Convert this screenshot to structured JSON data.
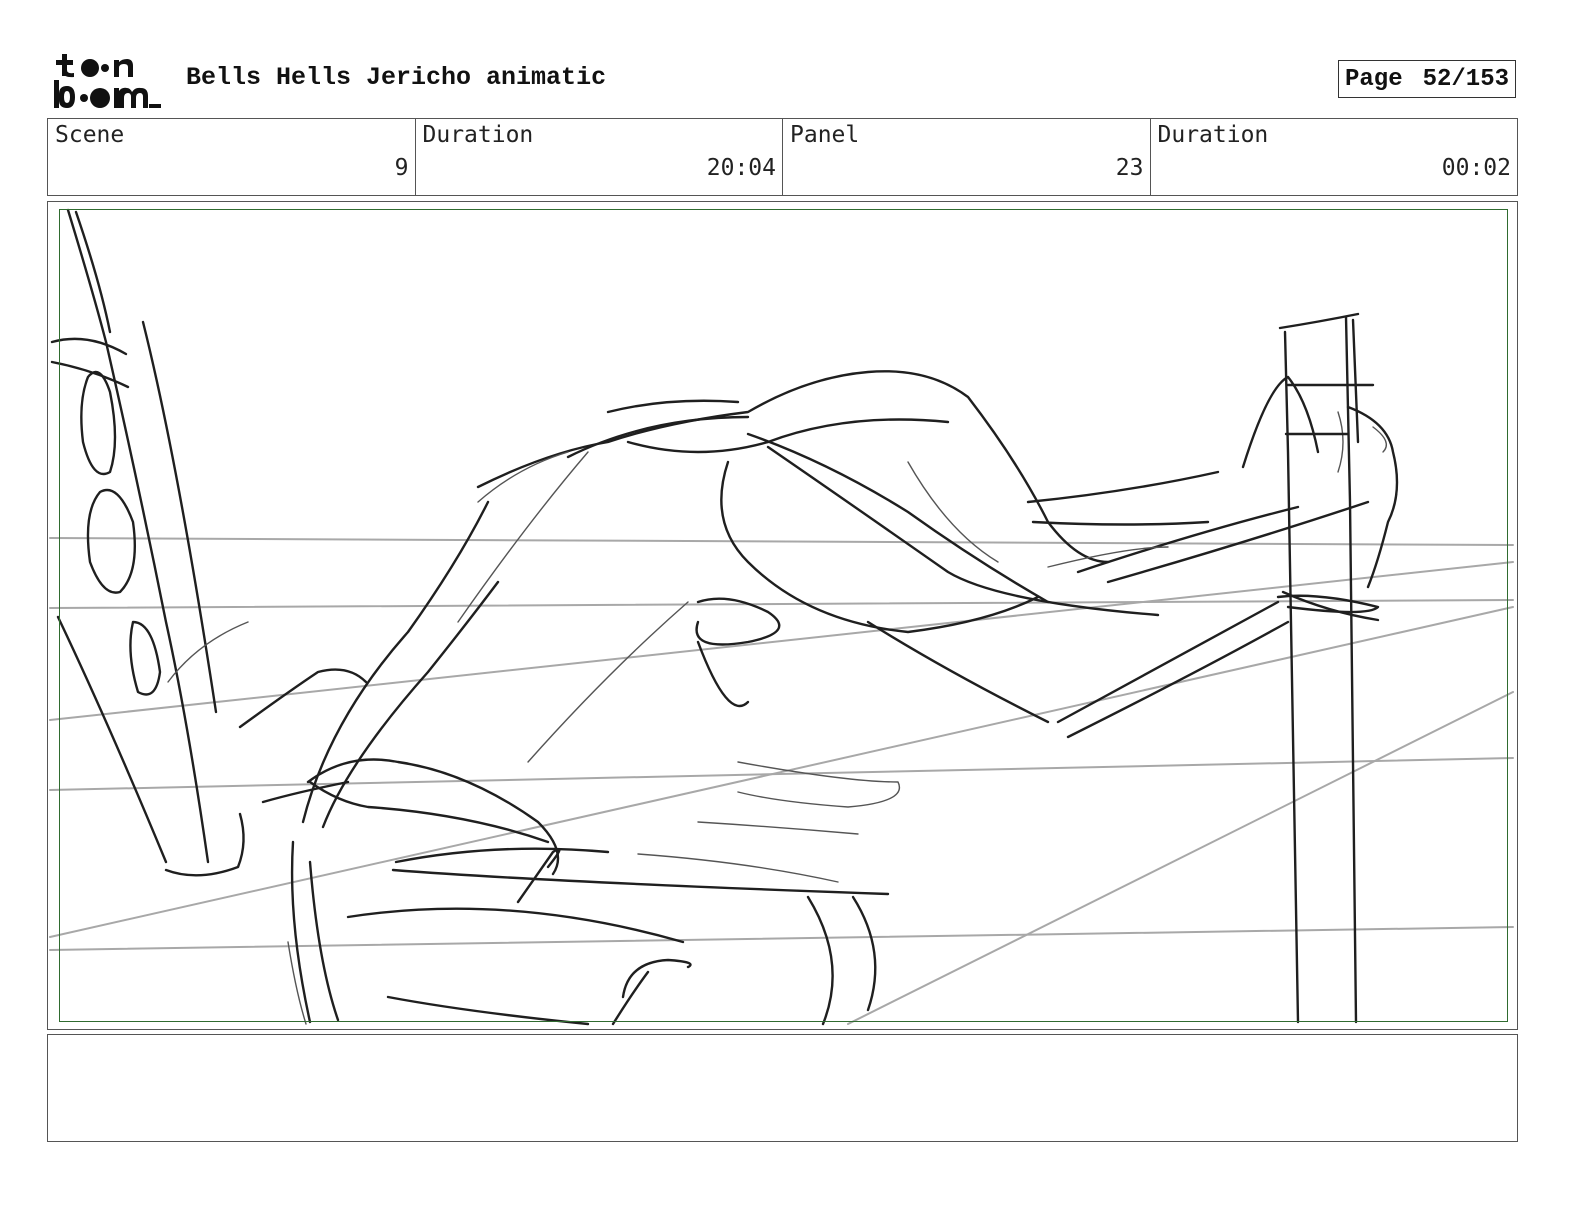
{
  "header": {
    "logo_text": "toon boom",
    "project_title": "Bells Hells Jericho animatic",
    "page_label": "Page",
    "page_number": "52/153"
  },
  "info": {
    "scene_label": "Scene",
    "scene_value": "9",
    "scene_duration_label": "Duration",
    "scene_duration_value": "20:04",
    "panel_label": "Panel",
    "panel_value": "23",
    "panel_duration_label": "Duration",
    "panel_duration_value": "00:02"
  },
  "notes": {
    "text": ""
  },
  "colors": {
    "safe_area_border": "#2f6b2f",
    "sketch_ink": "#1a1a1a",
    "guide_lines": "#a8a8a8"
  }
}
